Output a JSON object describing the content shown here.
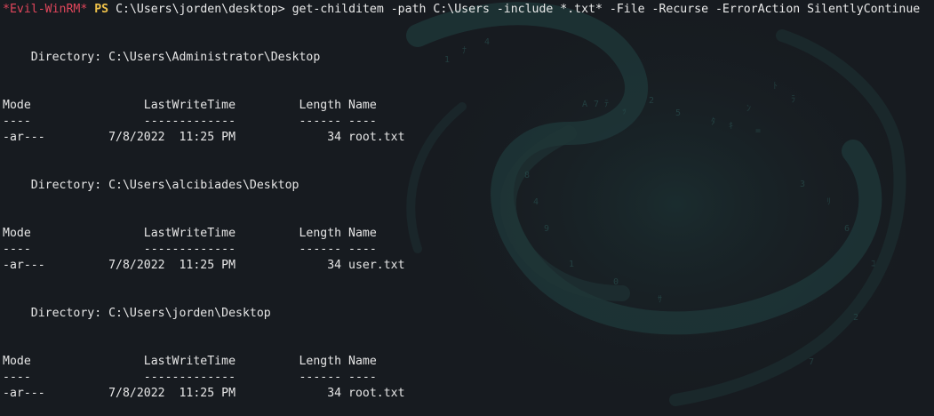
{
  "prompt": {
    "shell_name": "*Evil-WinRM*",
    "ps_label": "PS",
    "path": "C:\\Users\\jorden\\desktop>",
    "command": "get-childitem -path C:\\Users -include *.txt* -File -Recurse -ErrorAction SilentlyContinue"
  },
  "listings": [
    {
      "directory_line": "    Directory: C:\\Users\\Administrator\\Desktop",
      "header_line": "Mode                LastWriteTime         Length Name",
      "separator_line": "----                -------------         ------ ----",
      "row_line": "-ar---         7/8/2022  11:25 PM             34 root.txt"
    },
    {
      "directory_line": "    Directory: C:\\Users\\alcibiades\\Desktop",
      "header_line": "Mode                LastWriteTime         Length Name",
      "separator_line": "----                -------------         ------ ----",
      "row_line": "-ar---         7/8/2022  11:25 PM             34 user.txt"
    },
    {
      "directory_line": "    Directory: C:\\Users\\jorden\\Desktop",
      "header_line": "Mode                LastWriteTime         Length Name",
      "separator_line": "----                -------------         ------ ----",
      "row_line": "-ar---         7/8/2022  11:25 PM             34 root.txt"
    }
  ],
  "colors": {
    "background": "#171b20",
    "shell_name": "#e0465b",
    "ps_label": "#f0c24a",
    "text": "#e6e6e6"
  }
}
